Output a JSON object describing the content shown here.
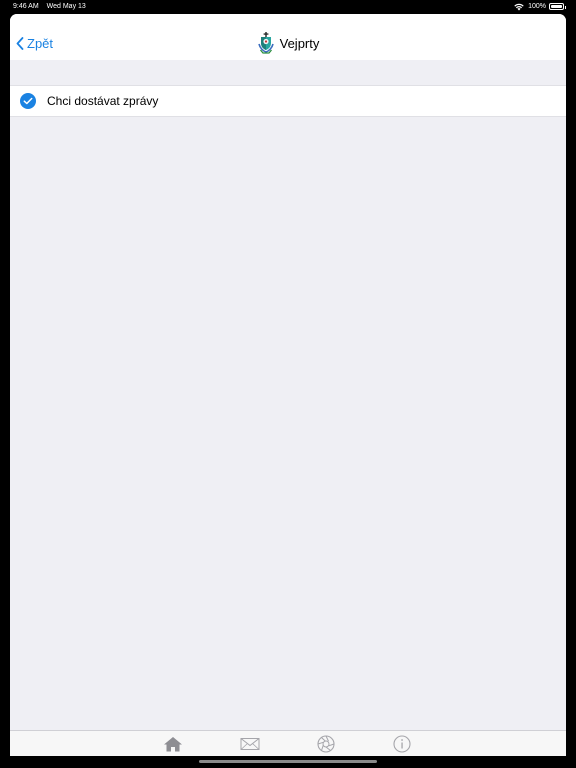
{
  "status_bar": {
    "time": "9:46 AM",
    "date": "Wed May 13",
    "battery": "100%",
    "icons": [
      "wifi-icon",
      "battery-icon"
    ]
  },
  "nav": {
    "back_label": "Zpět",
    "title": "Vejprty",
    "icons": [
      "chevron-left-icon",
      "town-crest-icon"
    ]
  },
  "settings": {
    "rows": [
      {
        "label": "Chci dostávat zprávy",
        "checked": true
      }
    ]
  },
  "tab_bar": {
    "tabs": [
      {
        "icon": "home-icon",
        "active": true
      },
      {
        "icon": "mail-icon",
        "active": false
      },
      {
        "icon": "aperture-icon",
        "active": false
      },
      {
        "icon": "info-icon",
        "active": false
      }
    ]
  },
  "colors": {
    "accent": "#1a82e2",
    "background": "#efeff4",
    "tab_active": "#8e8e93",
    "tab_inactive": "#a5a5aa"
  }
}
